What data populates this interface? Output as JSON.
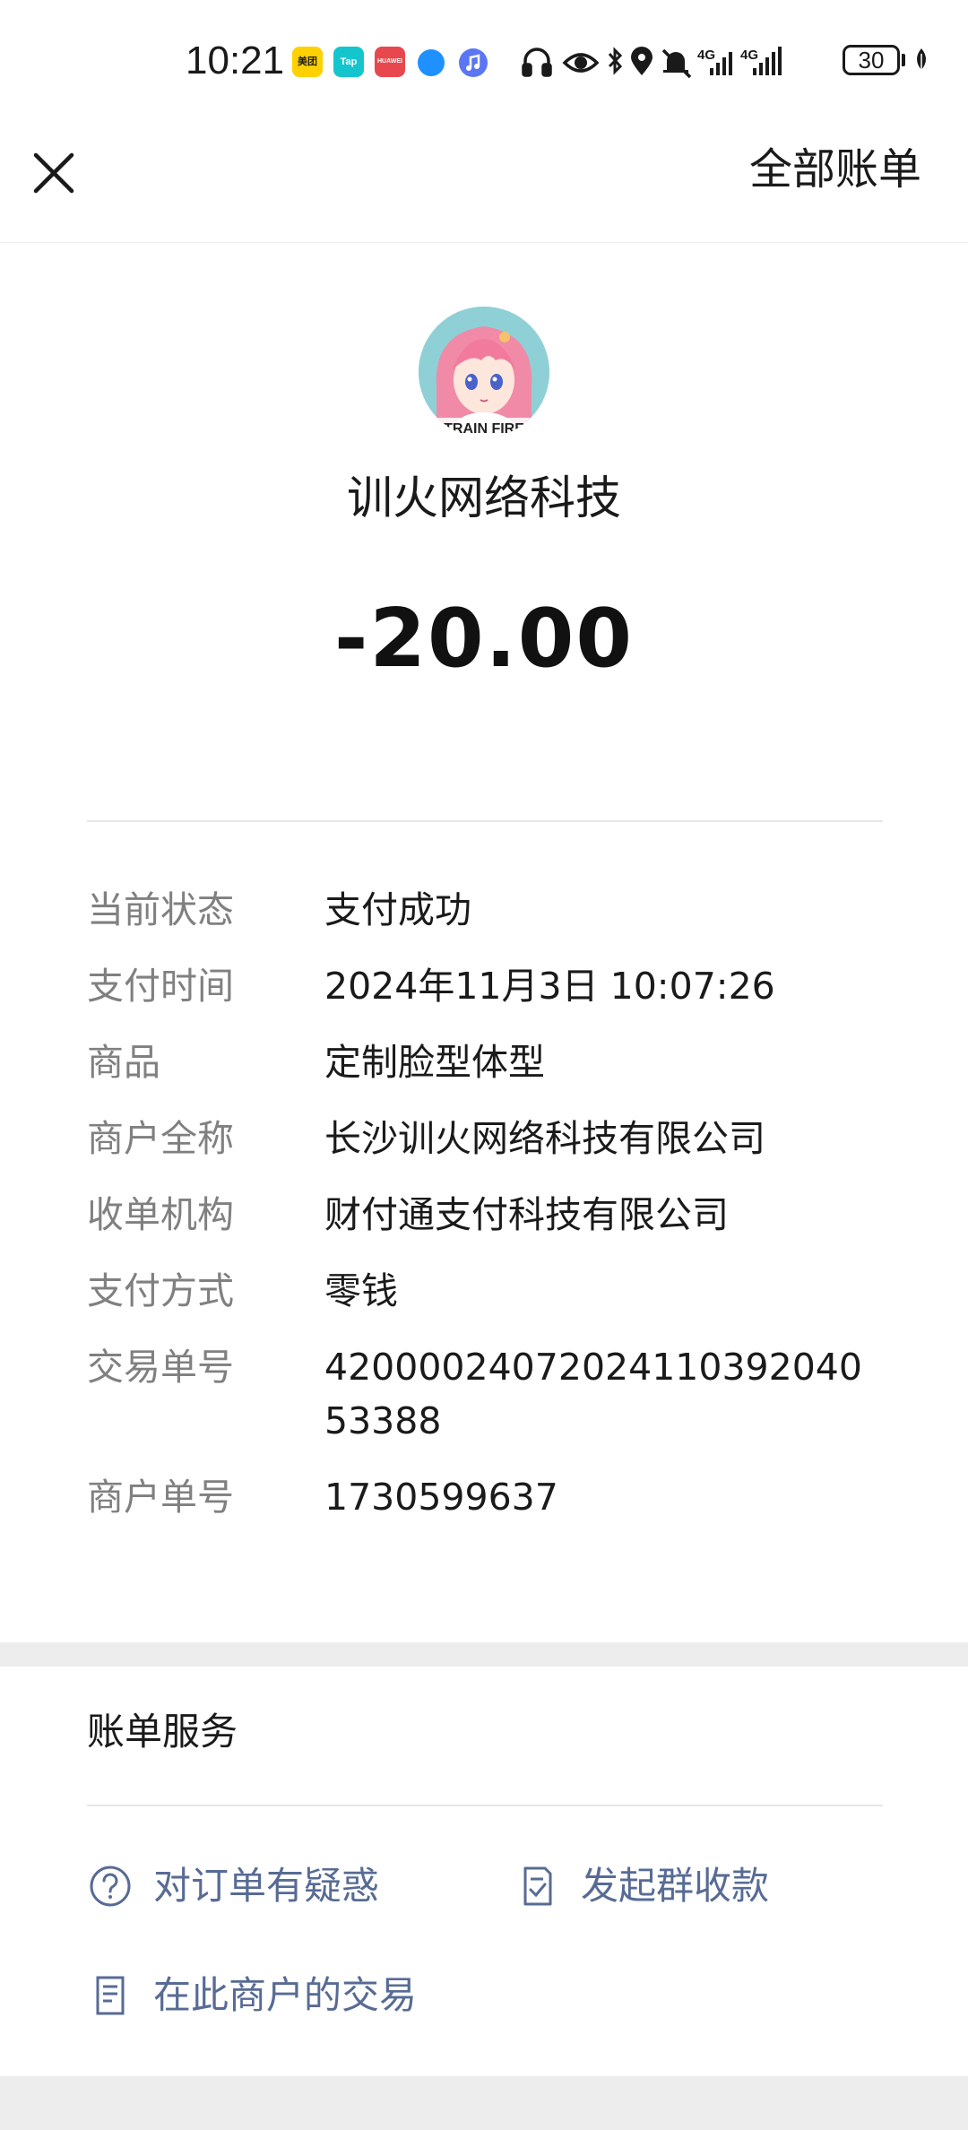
{
  "status_bar": {
    "time": "10:21",
    "apps": [
      {
        "name": "meituan",
        "text": "美团"
      },
      {
        "name": "tap",
        "text": "Tap"
      },
      {
        "name": "huawei",
        "text": "HUAWEI"
      }
    ],
    "network": "4G",
    "battery": "30",
    "icons": [
      "headphones-icon",
      "eye-icon",
      "bluetooth-icon",
      "location-icon",
      "mute-icon",
      "signal-icon",
      "battery-icon",
      "leaf-icon"
    ]
  },
  "nav": {
    "close_icon": "close-icon",
    "all_bills": "全部账单"
  },
  "merchant": {
    "avatar_text": "TRAIN FIRE",
    "name": "训火网络科技",
    "amount": "-20.00"
  },
  "details": [
    {
      "label": "当前状态",
      "value": "支付成功"
    },
    {
      "label": "支付时间",
      "value": "2024年11月3日 10:07:26"
    },
    {
      "label": "商品",
      "value": "定制脸型体型"
    },
    {
      "label": "商户全称",
      "value": "长沙训火网络科技有限公司"
    },
    {
      "label": "收单机构",
      "value": "财付通支付科技有限公司"
    },
    {
      "label": "支付方式",
      "value": "零钱"
    },
    {
      "label": "交易单号",
      "value": "4200002407202411039204053388"
    },
    {
      "label": "商户单号",
      "value": "1730599637"
    }
  ],
  "service": {
    "title": "账单服务",
    "doubt": "对订单有疑惑",
    "group_collect": "发起群收款",
    "merchant_trades": "在此商户的交易"
  },
  "colors": {
    "link": "#576b95",
    "label_gray": "#808080",
    "section_gap": "#ededed"
  }
}
